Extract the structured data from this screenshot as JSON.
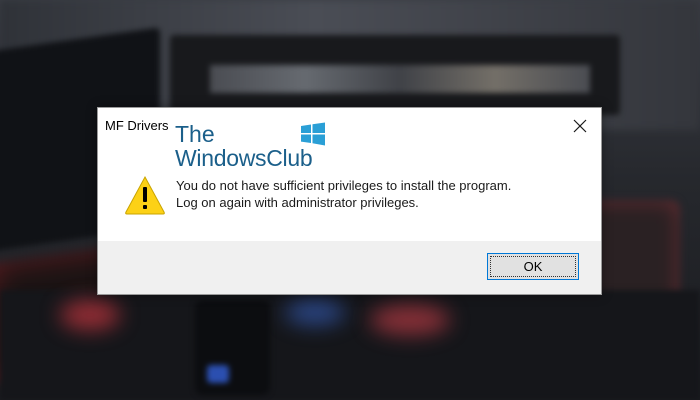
{
  "dialog": {
    "title": "MF Drivers",
    "message_line1": "You do not have sufficient privileges to install the program.",
    "message_line2": "Log on again with administrator privileges.",
    "ok_label": "OK",
    "icon": "warning-icon",
    "close_icon": "close-icon"
  },
  "watermark": {
    "line1": "The",
    "line2": "WindowsClub",
    "logo": "windows-logo-icon"
  },
  "colors": {
    "dialog_bg": "#ffffff",
    "footer_bg": "#f0f0f0",
    "button_border": "#0078d7",
    "warning_yellow": "#fcd116",
    "watermark_blue": "#1b5f8a",
    "logo_blue": "#2a9fd6"
  }
}
